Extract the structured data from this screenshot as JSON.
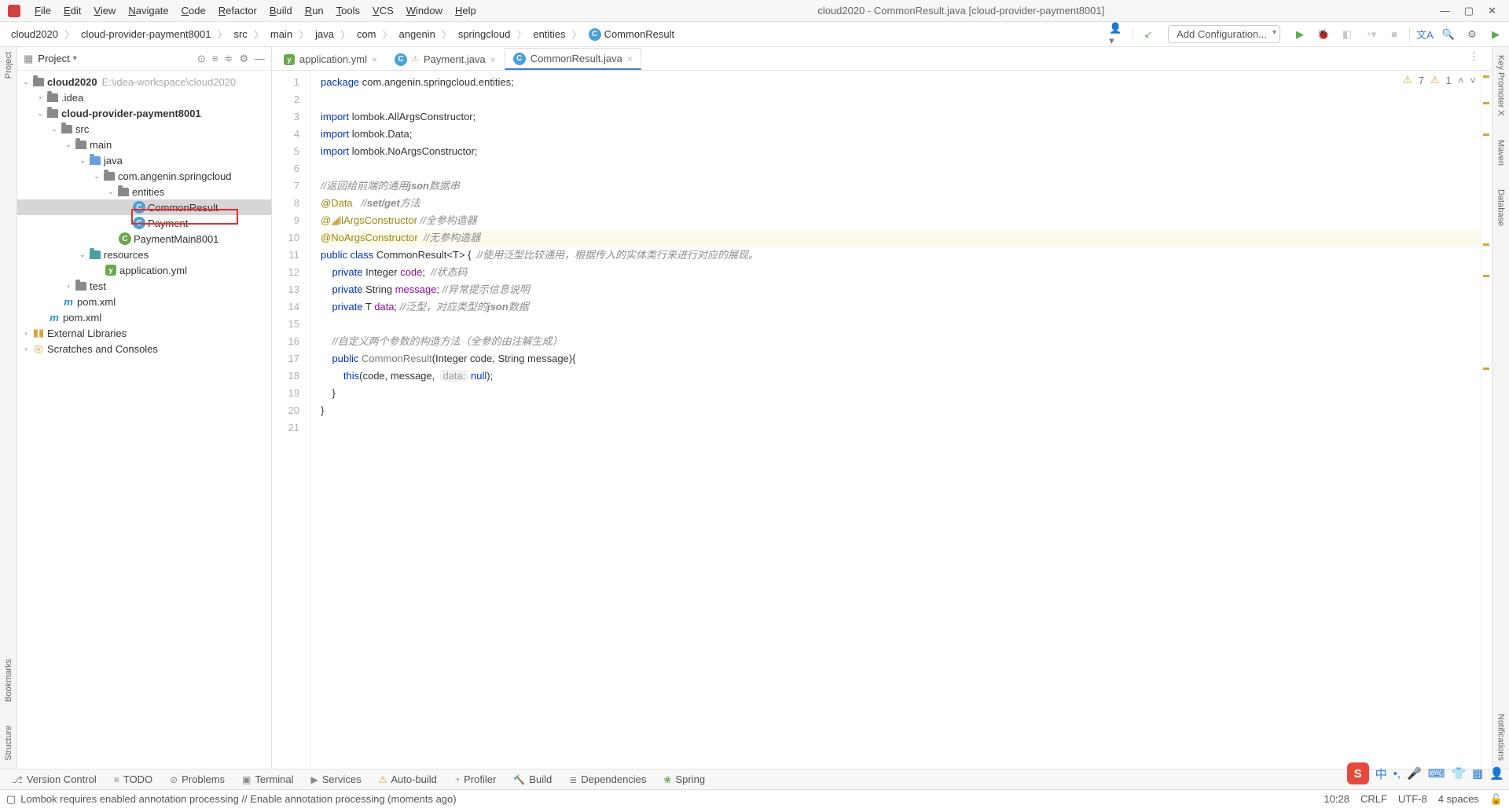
{
  "window": {
    "title": "cloud2020 - CommonResult.java [cloud-provider-payment8001]"
  },
  "menu": [
    "File",
    "Edit",
    "View",
    "Navigate",
    "Code",
    "Refactor",
    "Build",
    "Run",
    "Tools",
    "VCS",
    "Window",
    "Help"
  ],
  "breadcrumbs": [
    "cloud2020",
    "cloud-provider-payment8001",
    "src",
    "main",
    "java",
    "com",
    "angenin",
    "springcloud",
    "entities",
    "CommonResult"
  ],
  "run_config": {
    "add_label": "Add Configuration..."
  },
  "project_pane": {
    "title": "Project",
    "tree": {
      "root": {
        "label": "cloud2020",
        "hint": "E:\\idea-workspace\\cloud2020"
      },
      "idea": ".idea",
      "module": "cloud-provider-payment8001",
      "src": "src",
      "main": "main",
      "java": "java",
      "pkg": "com.angenin.springcloud",
      "entities": "entities",
      "common_result": "CommonResult",
      "payment": "Payment",
      "payment_main": "PaymentMain8001",
      "resources": "resources",
      "app_yml": "application.yml",
      "test": "test",
      "pom_inner": "pom.xml",
      "pom_outer": "pom.xml",
      "ext_libs": "External Libraries",
      "scratches": "Scratches and Consoles"
    }
  },
  "tabs": [
    {
      "label": "application.yml",
      "active": false,
      "icon": "yml"
    },
    {
      "label": "Payment.java",
      "active": false,
      "icon": "class",
      "warn": true
    },
    {
      "label": "CommonResult.java",
      "active": true,
      "icon": "class"
    }
  ],
  "inspections": {
    "warn1_count": "7",
    "warn2_count": "1"
  },
  "code_lines": [
    {
      "n": 1,
      "html": "<span class='kw'>package</span> com.angenin.springcloud.entities;"
    },
    {
      "n": 2,
      "html": ""
    },
    {
      "n": 3,
      "html": "<span class='kw'>import</span> lombok.AllArgsConstructor;"
    },
    {
      "n": 4,
      "html": "<span class='kw'>import</span> lombok.Data;"
    },
    {
      "n": 5,
      "html": "<span class='kw'>import</span> lombok.NoArgsConstructor;"
    },
    {
      "n": 6,
      "html": ""
    },
    {
      "n": 7,
      "html": "<span class='cm'>//返回给前端的通用<span class='cm-k'>json</span>数据串</span>"
    },
    {
      "n": 8,
      "html": "<span class='ann'>@Data</span>   <span class='cm'>//<span class='cm-k'>set/get</span>方法</span>"
    },
    {
      "n": 9,
      "html": "<span class='ann'>@<span class='lamp'>◢</span>llArgsConstructor</span> <span class='cm'>//全参构造器</span>"
    },
    {
      "n": 10,
      "html": "<span class='ann'>@NoArgsConstructor</span>  <span class='cm'>//无参构造器</span>",
      "caret": true
    },
    {
      "n": 11,
      "html": "<span class='kw'>public</span> <span class='kw'>class</span> CommonResult&lt;T&gt; {  <span class='cm'>//使用泛型比较通用，根据传入的实体类行来进行对应的展现。</span>"
    },
    {
      "n": 12,
      "html": "    <span class='kw'>private</span> Integer <span class='fld'>code</span>;  <span class='cm'>//状态码</span>"
    },
    {
      "n": 13,
      "html": "    <span class='kw'>private</span> String <span class='fld'>message</span>; <span class='cm'>//异常提示信息说明</span>"
    },
    {
      "n": 14,
      "html": "    <span class='kw'>private</span> T <span class='fld'>data</span>; <span class='cm'>//泛型，对应类型的<span class='cm-k'>json</span>数据</span>"
    },
    {
      "n": 15,
      "html": ""
    },
    {
      "n": 16,
      "html": "    <span class='cm'>//自定义两个参数的构造方法（全参的由注解生成）</span>"
    },
    {
      "n": 17,
      "html": "    <span class='kw'>public</span> <span style='color:#777'>CommonResult</span>(Integer code, String message){"
    },
    {
      "n": 18,
      "html": "        <span class='kw'>this</span>(code, message,  <span class='hint-p'>data:</span> <span class='kw'>null</span>);"
    },
    {
      "n": 19,
      "html": "    }"
    },
    {
      "n": 20,
      "html": "}"
    },
    {
      "n": 21,
      "html": ""
    }
  ],
  "left_tools": [
    "Project",
    "Bookmarks",
    "Structure"
  ],
  "right_tools": [
    "Key Promoter X",
    "Maven",
    "Database",
    "Notifications"
  ],
  "bottom_tools": [
    {
      "label": "Version Control",
      "icon": "⎇"
    },
    {
      "label": "TODO",
      "icon": "≡"
    },
    {
      "label": "Problems",
      "icon": "⊘"
    },
    {
      "label": "Terminal",
      "icon": "▣"
    },
    {
      "label": "Services",
      "icon": "▶"
    },
    {
      "label": "Auto-build",
      "icon": "⚠",
      "warn": true
    },
    {
      "label": "Profiler",
      "icon": "◔"
    },
    {
      "label": "Build",
      "icon": "🔨"
    },
    {
      "label": "Dependencies",
      "icon": "≣"
    },
    {
      "label": "Spring",
      "icon": "❀"
    }
  ],
  "status": {
    "message": "Lombok requires enabled annotation processing // Enable annotation processing (moments ago)",
    "cursor": "10:28",
    "line_sep": "CRLF",
    "encoding": "UTF-8",
    "indent": "4 spaces"
  }
}
